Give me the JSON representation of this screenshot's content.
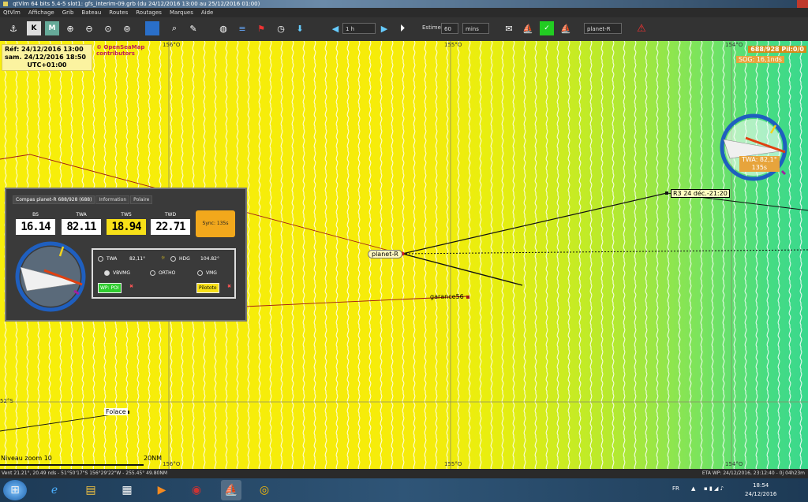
{
  "window": {
    "title": "qtVlm 64 bits 5.4-5 slot1: gfs_interim-09.grb (du 24/12/2016 13:00 au 25/12/2016 01:00)"
  },
  "menu": [
    "QtVlm",
    "Affichage",
    "Grib",
    "Bateau",
    "Routes",
    "Routages",
    "Marques",
    "Aide"
  ],
  "toolbar": {
    "step": "1 h",
    "estime_label": "Estime",
    "estime_value": "60",
    "estime_unit": "mins",
    "boat": "planet-R"
  },
  "map": {
    "ref_line1": "Réf: 24/12/2016 13:00",
    "ref_line2": "sam. 24/12/2016 18:50",
    "ref_line3": "UTC+01:00",
    "osm_line1": "© OpenSeaMap",
    "osm_line2": "contributors",
    "lon1": "156°O",
    "lon2": "155°O",
    "lon3": "154°O",
    "lat": "52°S",
    "pil": "688/928 Pil:0/0",
    "sog": "SOG: 16,1nds",
    "twa_line1": "TWA: 82,1°",
    "twa_line2": "135s",
    "route_label": "R3 24 déc.-21:20",
    "boat_label": "planet-R",
    "garance_label": "garance56",
    "folace_label": "Folace",
    "zoom": "Niveau zoom 10",
    "scale": "20NM"
  },
  "panel": {
    "tabs": [
      "Compas planet-R 688/928 (688)",
      "Information",
      "Polaire"
    ],
    "gauges": [
      {
        "label": "BS",
        "value": "16.14"
      },
      {
        "label": "TWA",
        "value": "82.11"
      },
      {
        "label": "TWS",
        "value": "18.94"
      },
      {
        "label": "TWD",
        "value": "22.71"
      }
    ],
    "sync": "Sync: 135s",
    "twa_label": "TWA",
    "twa_value": "82,11°",
    "hdg_label": "HDG",
    "hdg_value": "104.82°",
    "vbvmg": "VBVMG",
    "ortho": "ORTHO",
    "vmg": "VMG",
    "wp_btn": "WP: POI",
    "pilot_btn": "Pilototo"
  },
  "status": {
    "left": "Vent  21.21°,  20.49 nds  -  51°50'17\"S  156°29'22\"W  -  255.45°   49.80NM",
    "right": "ETA WP: 24/12/2016, 23:12:40 - 0j 04h23m"
  },
  "taskbar": {
    "lang": "FR",
    "time": "18:54",
    "date": "24/12/2016"
  },
  "colors": {
    "route": "#111111",
    "boat_track": "#b01a1a",
    "panel_bg": "#3a3a3a",
    "sync": "#f2a81c"
  }
}
